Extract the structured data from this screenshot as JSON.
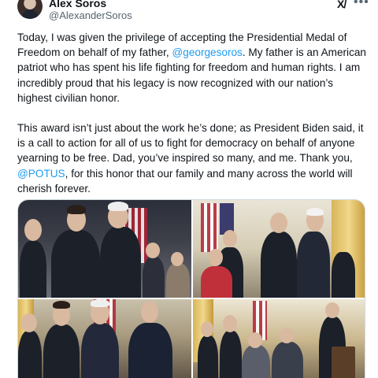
{
  "author": {
    "name": "Alex Soros",
    "handle": "@AlexanderSoros",
    "avatar": "avatar-photo"
  },
  "icons": {
    "grok": "grok-icon",
    "more": "more-options-icon"
  },
  "tweet": {
    "p1_a": "Today, I was given the privilege of accepting the Presidential Medal of Freedom on behalf of my father, ",
    "p1_mention": "@georgesoros",
    "p1_b": ". My father is an American patriot who has spent his life fighting for freedom and human rights. I am incredibly proud that his legacy is now recognized with our nation’s highest civilian honor.",
    "p2_a": "This award isn’t just about the work he’s done; as President Biden said, it is a call to action for all of us to fight for democracy on behalf of anyone yearning to be free. Dad, you’ve inspired so many, and me. Thank you, ",
    "p2_mention": "@POTUS",
    "p2_b": ", for this honor that our family and many across the world will cherish forever."
  },
  "media": {
    "count": 4,
    "photos": [
      "ceremony-photo-1",
      "ceremony-photo-2",
      "ceremony-photo-3",
      "ceremony-photo-4"
    ]
  },
  "colors": {
    "text": "#0f1419",
    "secondary": "#536471",
    "link": "#1d9bf0",
    "border": "#cfd9de"
  }
}
